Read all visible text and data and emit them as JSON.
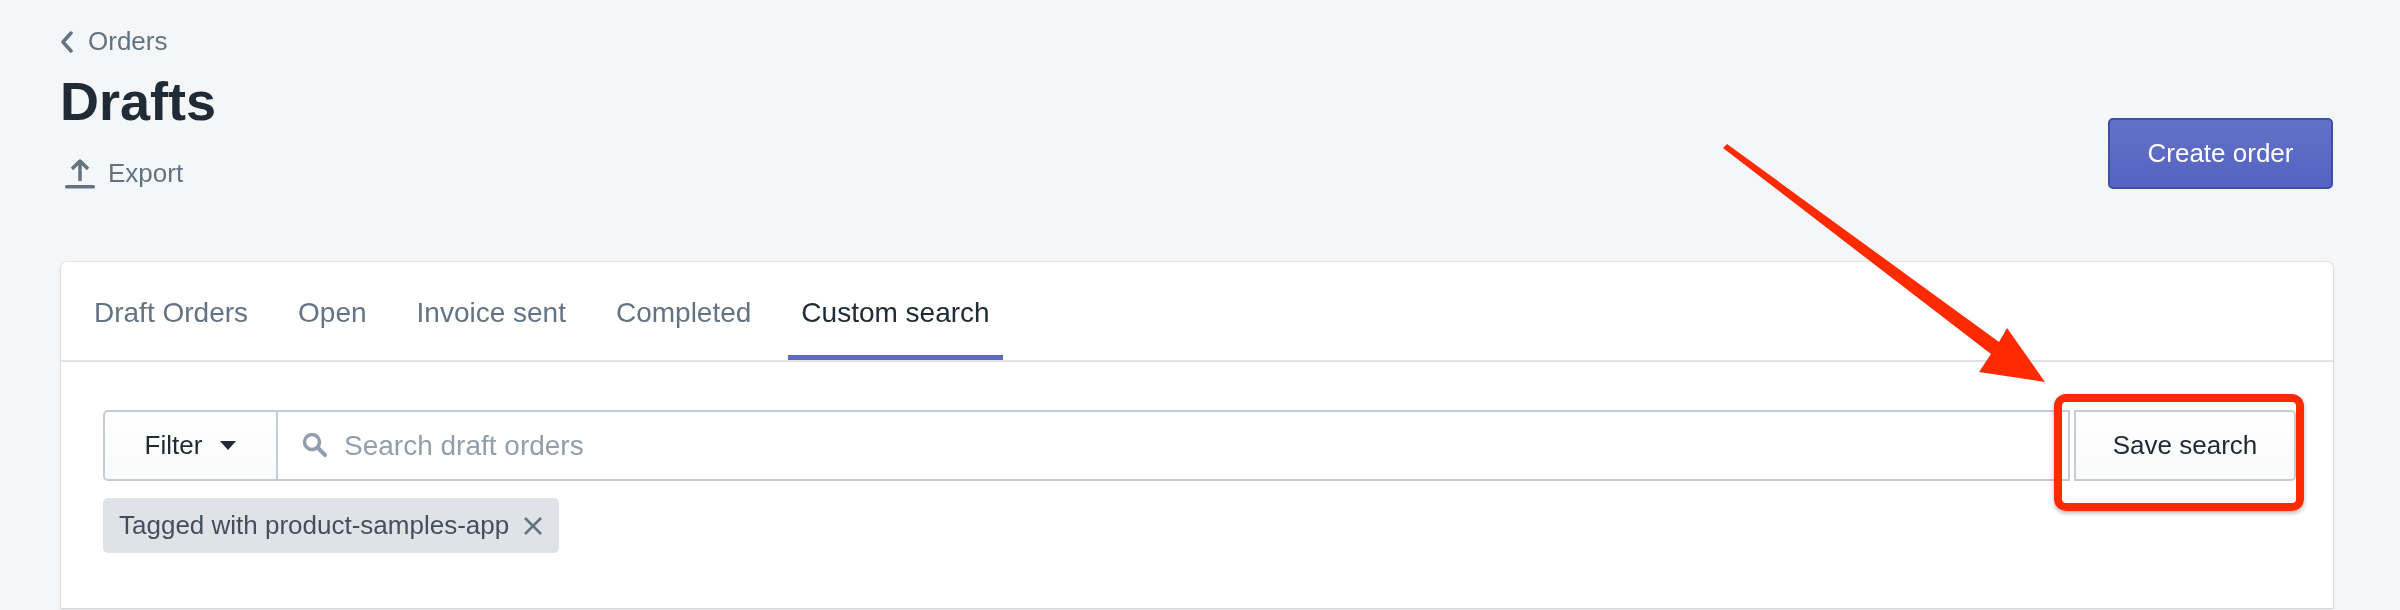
{
  "breadcrumb": {
    "label": "Orders"
  },
  "title": "Drafts",
  "actions": [
    {
      "label": "Export"
    }
  ],
  "primary_button": {
    "label": "Create order"
  },
  "tabs": [
    {
      "label": "Draft Orders",
      "selected": false
    },
    {
      "label": "Open",
      "selected": false
    },
    {
      "label": "Invoice sent",
      "selected": false
    },
    {
      "label": "Completed",
      "selected": false
    },
    {
      "label": "Custom search",
      "selected": true
    }
  ],
  "filter_button": {
    "label": "Filter"
  },
  "search": {
    "placeholder": "Search draft orders"
  },
  "save_button": {
    "label": "Save search"
  },
  "filter_tags": [
    {
      "label": "Tagged with product-samples-app"
    }
  ]
}
